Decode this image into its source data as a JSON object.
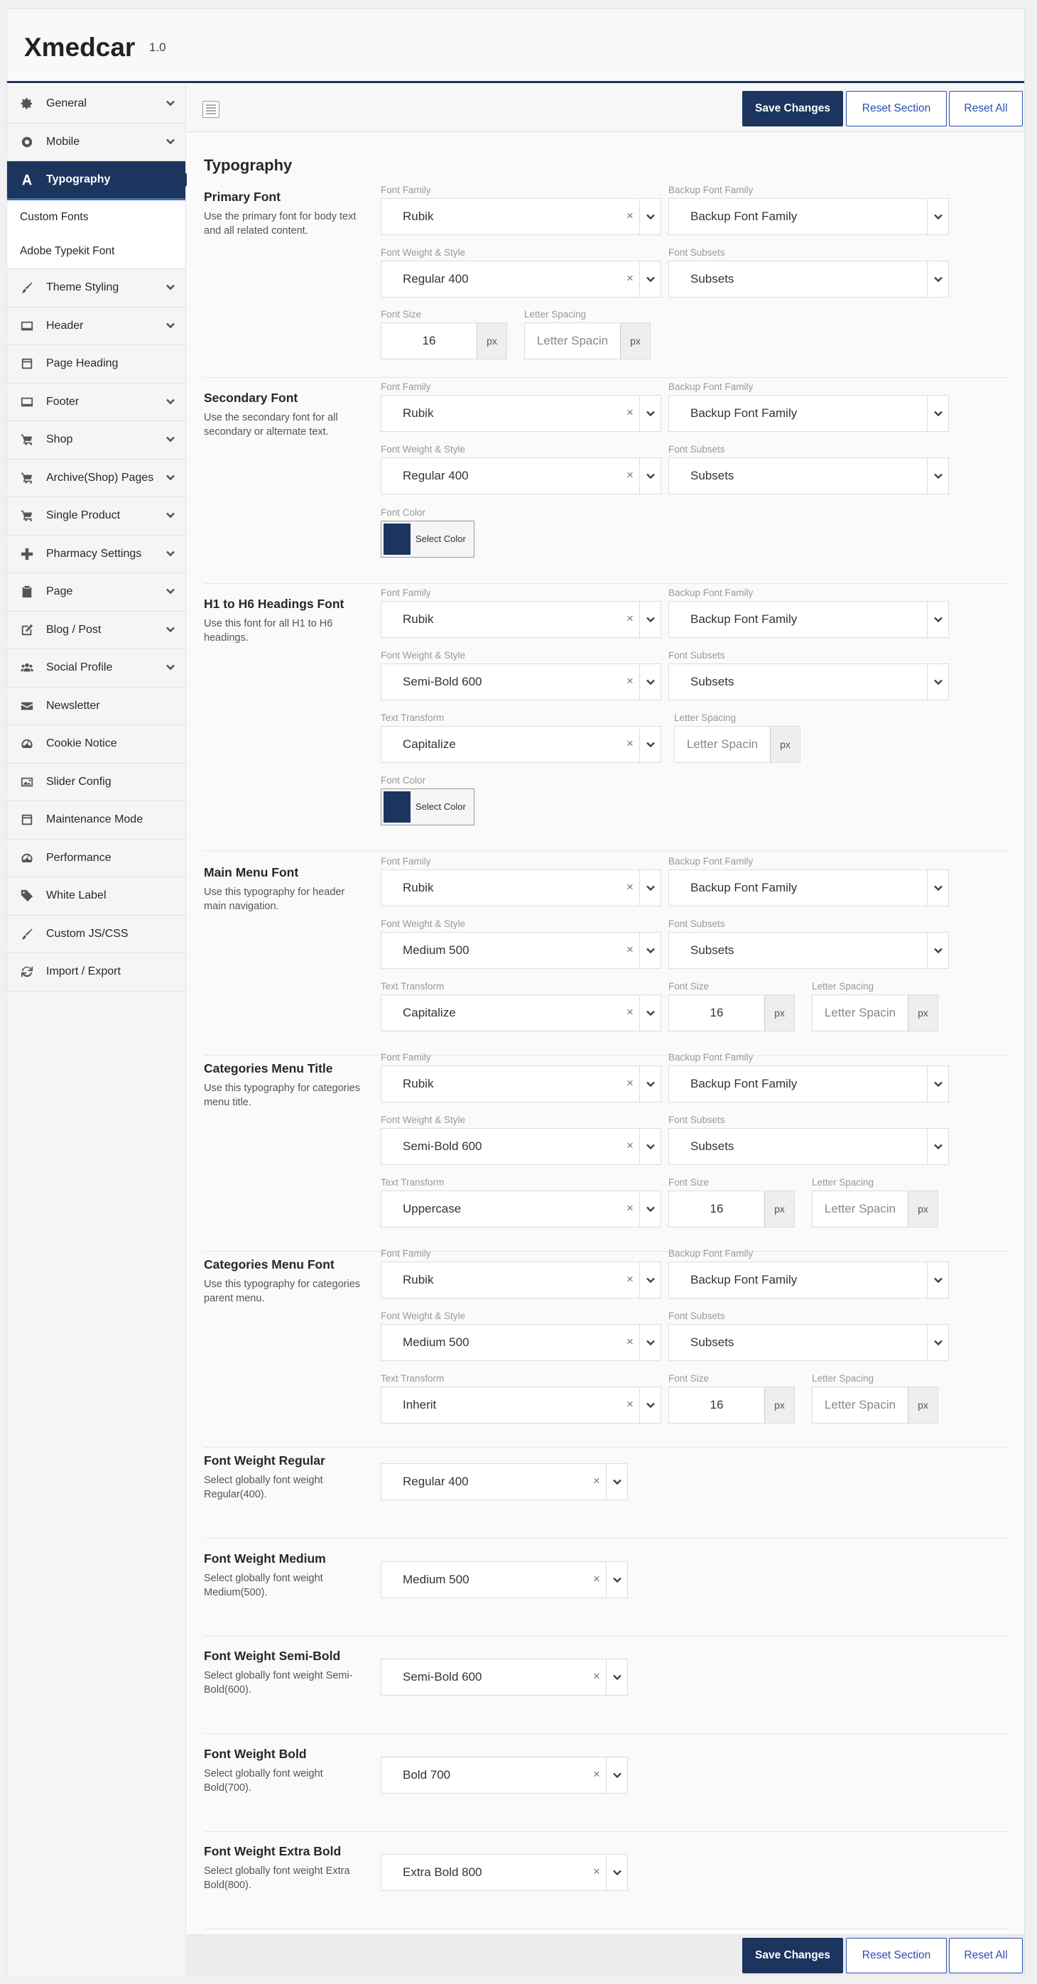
{
  "app": {
    "name": "Xmedcar",
    "version": "1.0"
  },
  "sidebar": {
    "items": [
      {
        "label": "General",
        "icon": "gear-icon",
        "chevron": true
      },
      {
        "label": "Mobile",
        "icon": "mobile-icon",
        "chevron": true
      },
      {
        "label": "Typography",
        "icon": "font-icon",
        "chevron": false,
        "active": true
      },
      {
        "label": "Theme Styling",
        "icon": "brush-icon",
        "chevron": true
      },
      {
        "label": "Header",
        "icon": "window-icon",
        "chevron": true
      },
      {
        "label": "Page Heading",
        "icon": "layout-icon",
        "chevron": false
      },
      {
        "label": "Footer",
        "icon": "window-icon",
        "chevron": true
      },
      {
        "label": "Shop",
        "icon": "cart-icon",
        "chevron": true
      },
      {
        "label": "Archive(Shop) Pages",
        "icon": "cart-icon",
        "chevron": true
      },
      {
        "label": "Single Product",
        "icon": "cart-icon",
        "chevron": true
      },
      {
        "label": "Pharmacy Settings",
        "icon": "plus-icon",
        "chevron": true
      },
      {
        "label": "Page",
        "icon": "clipboard-icon",
        "chevron": true
      },
      {
        "label": "Blog / Post",
        "icon": "edit-icon",
        "chevron": true
      },
      {
        "label": "Social Profile",
        "icon": "users-icon",
        "chevron": true
      },
      {
        "label": "Newsletter",
        "icon": "envelope-icon",
        "chevron": false
      },
      {
        "label": "Cookie Notice",
        "icon": "dashboard-icon",
        "chevron": false
      },
      {
        "label": "Slider Config",
        "icon": "image-icon",
        "chevron": false
      },
      {
        "label": "Maintenance Mode",
        "icon": "layout-icon",
        "chevron": false
      },
      {
        "label": "Performance",
        "icon": "dashboard-icon",
        "chevron": false
      },
      {
        "label": "White Label",
        "icon": "tag-icon",
        "chevron": false
      },
      {
        "label": "Custom JS/CSS",
        "icon": "brush-icon",
        "chevron": false
      },
      {
        "label": "Import / Export",
        "icon": "refresh-icon",
        "chevron": false
      }
    ],
    "subitems": [
      "Custom Fonts",
      "Adobe Typekit Font"
    ]
  },
  "toolbar": {
    "save": "Save Changes",
    "reset_section": "Reset Section",
    "reset_all": "Reset All"
  },
  "section_title": "Typography",
  "labels": {
    "font_family": "Font Family",
    "backup_font_family": "Backup Font Family",
    "font_weight_style": "Font Weight & Style",
    "font_subsets": "Font Subsets",
    "font_size": "Font Size",
    "letter_spacing": "Letter Spacing",
    "font_color": "Font Color",
    "text_transform": "Text Transform",
    "px": "px",
    "select_color": "Select Color",
    "clear": "×"
  },
  "placeholders": {
    "backup_font_family": "Backup Font Family",
    "subsets": "Subsets",
    "letter_spacing": "Letter Spacin"
  },
  "groups": {
    "primary": {
      "title": "Primary Font",
      "desc": "Use the primary font for body text and all related content.",
      "family": "Rubik",
      "weight": "Regular 400",
      "size": "16"
    },
    "secondary": {
      "title": "Secondary Font",
      "desc": "Use the secondary font for all secondary or alternate text.",
      "family": "Rubik",
      "weight": "Regular 400",
      "color": "#1b355e"
    },
    "headings": {
      "title": "H1 to H6 Headings Font",
      "desc": "Use this font for all H1 to H6 headings.",
      "family": "Rubik",
      "weight": "Semi-Bold 600",
      "transform": "Capitalize",
      "color": "#1b355e"
    },
    "main_menu": {
      "title": "Main Menu Font",
      "desc": "Use this typography for header main navigation.",
      "family": "Rubik",
      "weight": "Medium 500",
      "transform": "Capitalize",
      "size": "16"
    },
    "cat_title": {
      "title": "Categories Menu Title",
      "desc": "Use this typography for categories menu title.",
      "family": "Rubik",
      "weight": "Semi-Bold 600",
      "transform": "Uppercase",
      "size": "16"
    },
    "cat_font": {
      "title": "Categories Menu Font",
      "desc": "Use this typography for categories parent menu.",
      "family": "Rubik",
      "weight": "Medium 500",
      "transform": "Inherit",
      "size": "16"
    }
  },
  "globals": [
    {
      "title": "Font Weight Regular",
      "desc": "Select globally font weight Regular(400).",
      "value": "Regular 400"
    },
    {
      "title": "Font Weight Medium",
      "desc": "Select globally font weight Medium(500).",
      "value": "Medium 500"
    },
    {
      "title": "Font Weight Semi-Bold",
      "desc": "Select globally font weight Semi-Bold(600).",
      "value": "Semi-Bold 600"
    },
    {
      "title": "Font Weight Bold",
      "desc": "Select globally font weight Bold(700).",
      "value": "Bold 700"
    },
    {
      "title": "Font Weight Extra Bold",
      "desc": "Select globally font weight Extra Bold(800).",
      "value": "Extra Bold 800"
    }
  ],
  "colors": {
    "brand": "#1b355e",
    "link": "#2a4fb0"
  }
}
